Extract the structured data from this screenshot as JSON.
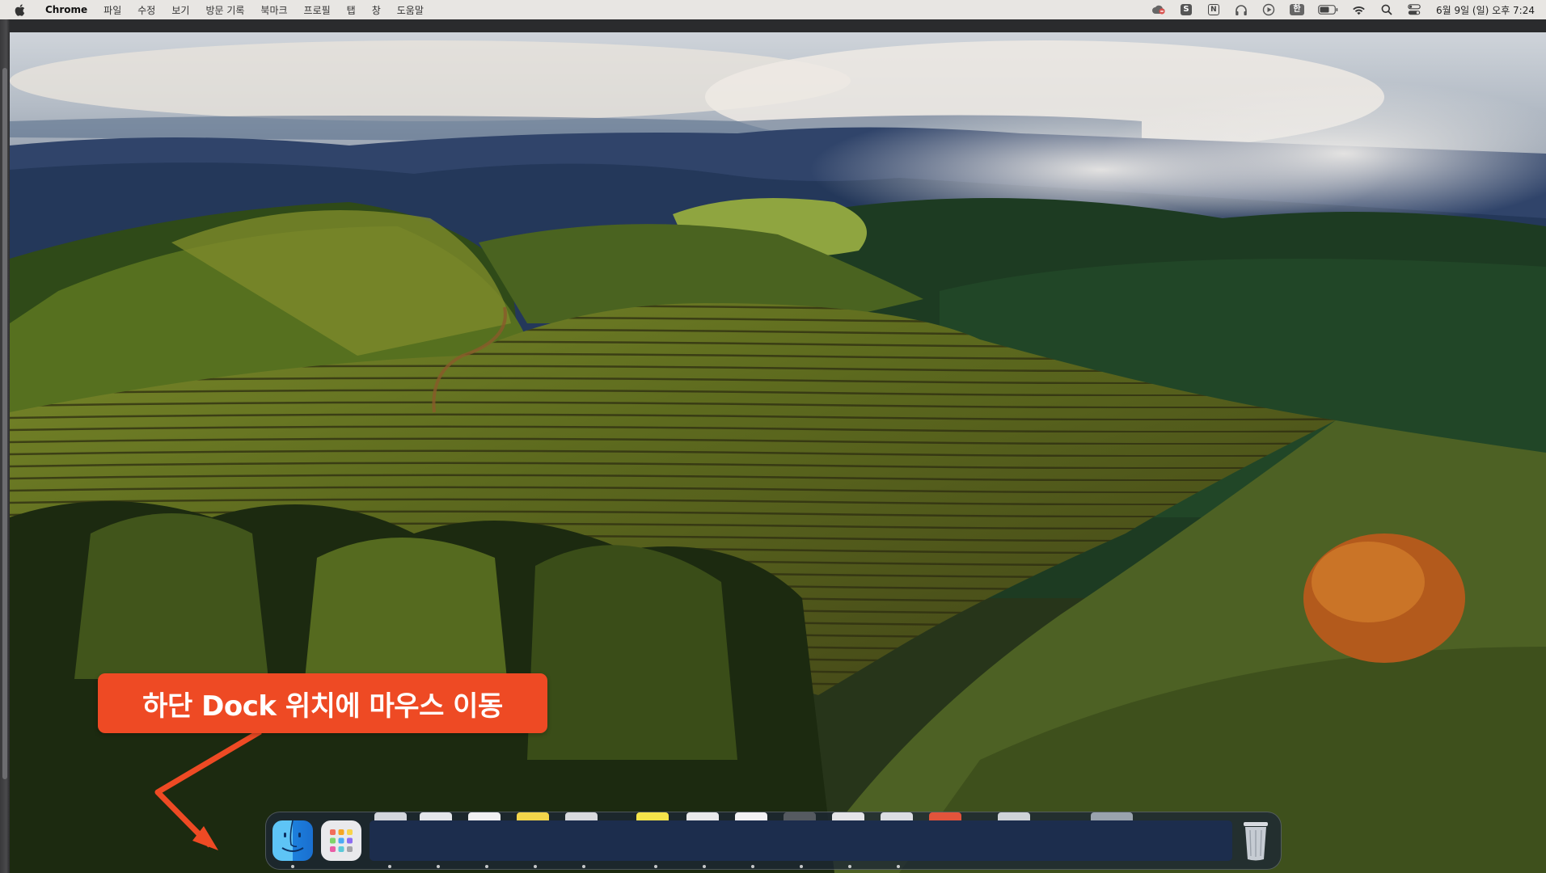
{
  "menubar": {
    "app_name": "Chrome",
    "items": [
      "파일",
      "수정",
      "보기",
      "방문 기록",
      "북마크",
      "프로필",
      "탭",
      "창",
      "도움말"
    ],
    "status_icons": [
      "creative-cloud-icon",
      "s-app-icon",
      "notion-icon",
      "headphones-icon",
      "play-icon",
      "input-source-icon",
      "battery-icon",
      "wifi-icon",
      "spotlight-search-icon",
      "control-center-icon"
    ],
    "input_source_label": "한",
    "s_app_label": "S",
    "notion_label": "N",
    "clock": "6월 9일 (일) 오후 7:24"
  },
  "callout": {
    "text": "하단 Dock 위치에 마우스 이동",
    "color": "#ee4a24"
  },
  "dock": {
    "apps": [
      "finder-icon",
      "launchpad-icon"
    ],
    "trash_icon": "trash-icon"
  }
}
